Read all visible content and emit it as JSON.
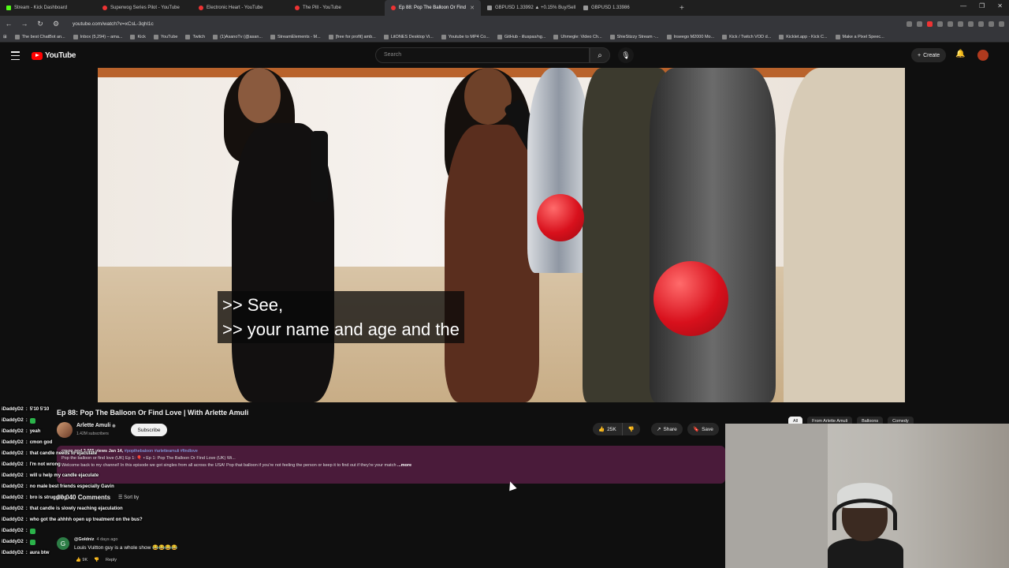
{
  "browser": {
    "tabs": [
      {
        "title": "Stream - Kick Dashboard",
        "type": "k"
      },
      {
        "title": "Superwog Series Pilot - YouTube",
        "type": "yt"
      },
      {
        "title": "Electronic Heart - YouTube",
        "type": "yt"
      },
      {
        "title": "The Pill - YouTube",
        "type": "yt"
      },
      {
        "title": "Ep 88: Pop The Balloon Or Find",
        "type": "yt",
        "active": true
      },
      {
        "title": "GBPUSD 1.33992 ▲ +0.15% Buy/Sell",
        "type": "d"
      },
      {
        "title": "GBPUSD 1.33986",
        "type": "d"
      }
    ],
    "url": "youtube.com/watch?v=xCsL-3qhl1c",
    "bookmarks": [
      "The best ChatBot an...",
      "Inbox (5,294) – ama...",
      "Kick",
      "YouTube",
      "Twitch",
      "(1)AsanoTv (@asan...",
      "StreamElements - M...",
      "[free for profit] amb...",
      "LitONES Desktop Vi...",
      "Youtube to MP4 Co...",
      "GitHub - illuspas/ng...",
      "Uhmegle: Video Ch...",
      "ShieStizzy Stream -...",
      "Inseego M2000 Mo...",
      "Kick / Twitch VOD d...",
      "Kicklet.app - Kick C...",
      "Make a Pixel Speec..."
    ]
  },
  "youtube": {
    "logo_text": "YouTube",
    "search_placeholder": "Search",
    "create_label": "Create"
  },
  "video": {
    "caption_line1": ">> See,",
    "caption_line2": ">> your name and age and the",
    "title": "Ep 88: Pop The Balloon Or Find Love | With Arlette Amuli",
    "channel_name": "Arlette Amuli",
    "subscribers": "1.42M subscribers",
    "subscribe_label": "Subscribe",
    "likes": "25K",
    "share_label": "Share",
    "save_label": "Save",
    "description": {
      "meta": "cmon god 3,055 views  Jan 14,",
      "tags": "#popthebaloon #arletteamuli #findlove",
      "line2": "Pop the balloon or find love (UK) Ep 1: 🎈 • Ep 1: Pop The Balloon Or Find Love (UK) Wi...",
      "line3": "Welcome back to my channel! In this episode we got singles from all across the USA! Pop that balloon if you're not feeling the person or keep it to find out if they're your match",
      "more": "...more"
    },
    "comments_count": "10,040 Comments",
    "sort_label": "Sort by"
  },
  "chips": [
    "All",
    "From Arlette Amuli",
    "Balloons",
    "Comedy"
  ],
  "chat": [
    {
      "user": "iDaddyD2",
      "text": "5'10 5'10"
    },
    {
      "user": "iDaddyD2",
      "text": ""
    },
    {
      "user": "iDaddyD2",
      "text": "yeah"
    },
    {
      "user": "iDaddyD2",
      "text": "cmon god"
    },
    {
      "user": "iDaddyD2",
      "text": "that candle needs to ejaculate"
    },
    {
      "user": "iDaddyD2",
      "text": "I'm not wrong"
    },
    {
      "user": "iDaddyD2",
      "text": "will u help my candle ejaculate"
    },
    {
      "user": "iDaddyD2",
      "text": "no male best friends especially Gavin"
    },
    {
      "user": "iDaddyD2",
      "text": "bro is struggling"
    },
    {
      "user": "iDaddyD2",
      "text": "that candle is slowly reaching ejaculation"
    },
    {
      "user": "iDaddyD2",
      "text": "who got the ahhhh open up treatment on the bus?"
    },
    {
      "user": "iDaddyD2",
      "text": ""
    },
    {
      "user": "iDaddyD2",
      "text": ""
    },
    {
      "user": "iDaddyD2",
      "text": "aura btw"
    }
  ],
  "comment": {
    "avatar_letter": "G",
    "user": "@Goldniz",
    "time": "4 days ago",
    "text": "Louis Vuitton guy is a whole show 😂😂😂😂",
    "likes": "9K",
    "reply_label": "Reply"
  },
  "colors": {
    "accent": "#ff0000",
    "background": "#0f0f0f",
    "description_bg": "#4a1b3a"
  }
}
